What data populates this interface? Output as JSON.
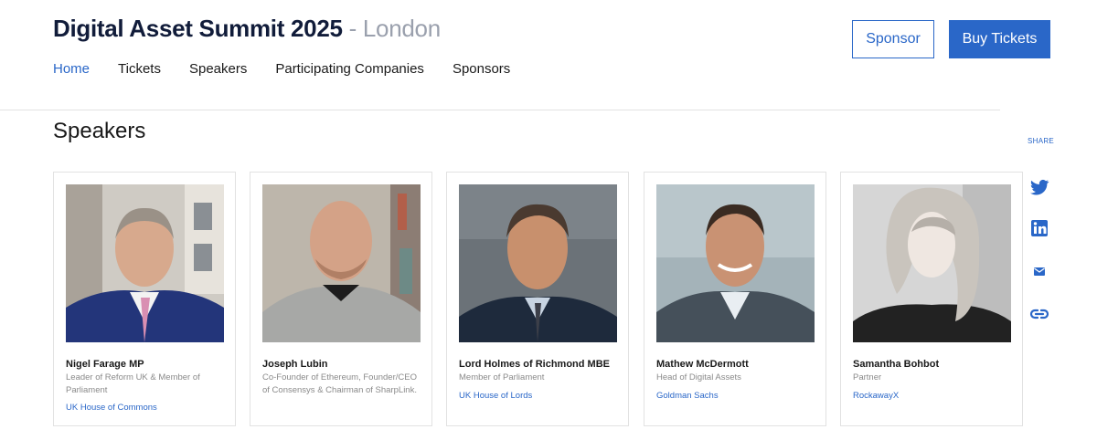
{
  "header": {
    "title": "Digital Asset Summit 2025",
    "separator": "-",
    "city": "London",
    "nav": [
      "Home",
      "Tickets",
      "Speakers",
      "Participating Companies",
      "Sponsors"
    ],
    "sponsor_label": "Sponsor",
    "buy_label": "Buy Tickets"
  },
  "section": {
    "title": "Speakers"
  },
  "speakers": [
    {
      "name": "Nigel Farage MP",
      "role": "Leader of Reform UK & Member of Parliament",
      "org": "UK House of Commons"
    },
    {
      "name": "Joseph Lubin",
      "role": "Co-Founder of Ethereum, Founder/CEO of Consensys & Chairman of SharpLink.",
      "org": ""
    },
    {
      "name": "Lord Holmes of Richmond MBE",
      "role": "Member of Parliament",
      "org": "UK House of Lords"
    },
    {
      "name": "Mathew McDermott",
      "role": "Head of Digital Assets",
      "org": "Goldman Sachs"
    },
    {
      "name": "Samantha Bohbot",
      "role": "Partner",
      "org": "RockawayX"
    }
  ],
  "share": {
    "label": "SHARE",
    "icons": [
      "twitter-icon",
      "linkedin-icon",
      "email-icon",
      "link-icon"
    ]
  },
  "colors": {
    "accent": "#2a67c8",
    "title": "#111c3a",
    "muted": "#9aa0ad"
  }
}
